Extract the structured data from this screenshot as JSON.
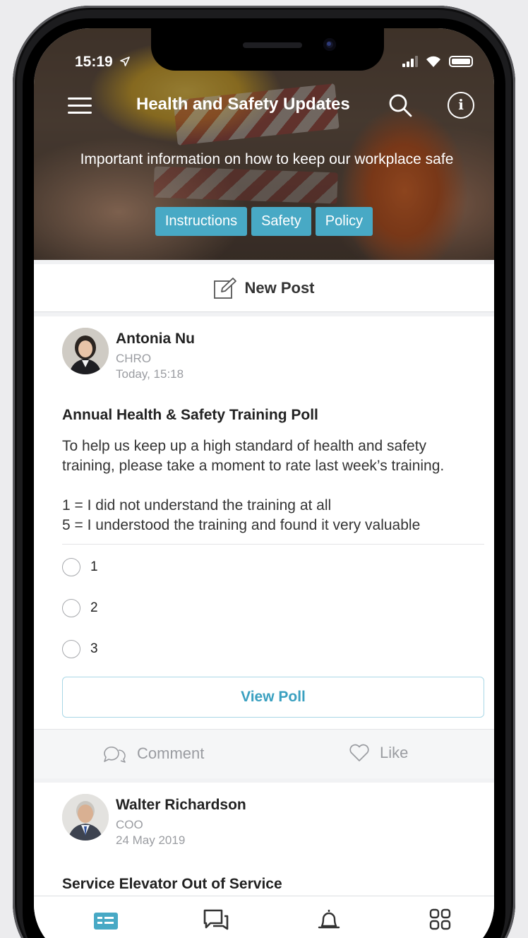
{
  "status_bar": {
    "time": "15:19"
  },
  "header": {
    "title": "Health and Safety Updates",
    "subtitle": "Important information on how to keep our workplace safe",
    "tags": [
      "Instructions",
      "Safety",
      "Policy"
    ]
  },
  "new_post": {
    "label": "New Post"
  },
  "posts": [
    {
      "author": "Antonia Nu",
      "role": "CHRO",
      "date": "Today, 15:18",
      "title": "Annual Health & Safety Training Poll",
      "body": [
        "To help us keep up a high standard of health and safety training, please take a moment to rate last week’s training.",
        "1 = I did not understand the training at all\n5 = I understood the training and found it very valuable"
      ],
      "options": [
        "1",
        "2",
        "3"
      ],
      "view_poll_label": "View Poll",
      "comment_label": "Comment",
      "like_label": "Like"
    },
    {
      "author": "Walter Richardson",
      "role": "COO",
      "date": "24 May 2019",
      "title": "Service Elevator Out of Service"
    }
  ],
  "colors": {
    "accent": "#48a9c5",
    "link": "#3aa0c0",
    "muted": "#9a9ca1"
  },
  "icons": {
    "status": [
      "location-arrow-icon",
      "signal-icon",
      "wifi-icon",
      "battery-icon"
    ],
    "header": [
      "menu-icon",
      "search-icon",
      "info-icon"
    ],
    "tabbar": [
      "feed-icon",
      "chat-icon",
      "bell-icon",
      "apps-grid-icon"
    ]
  }
}
